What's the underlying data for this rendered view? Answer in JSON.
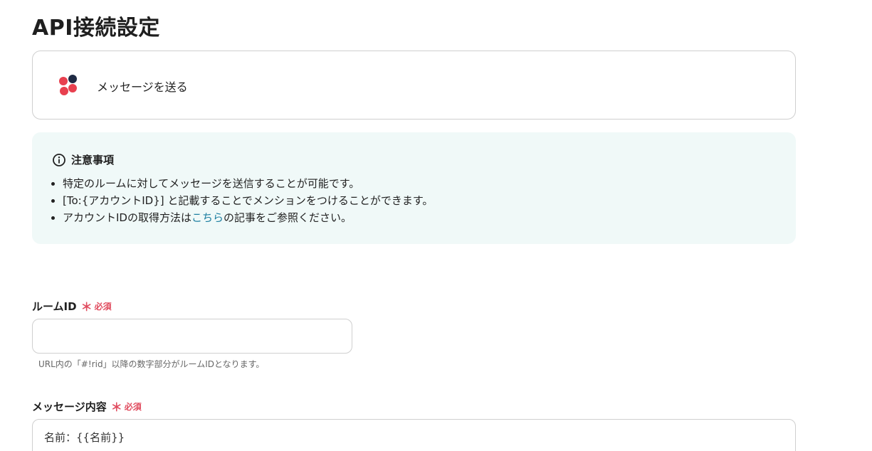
{
  "page": {
    "title": "API接続設定"
  },
  "action": {
    "label": "メッセージを送る",
    "logo_icon": "chatwork-logo-icon"
  },
  "notice": {
    "title": "注意事項",
    "items": [
      "特定のルームに対してメッセージを送信することが可能です。",
      "[To:{アカウントID}] と記載することでメンションをつけることができます。"
    ],
    "item3_prefix": "アカウントIDの取得方法は",
    "item3_link": "こちら",
    "item3_suffix": "の記事をご参照ください。"
  },
  "fields": {
    "room_id": {
      "label": "ルームID",
      "required_mark": "＊",
      "required_text": "必須",
      "value": "",
      "help": "URL内の「#!rid」以降の数字部分がルームIDとなります。"
    },
    "message": {
      "label": "メッセージ内容",
      "required_mark": "＊",
      "required_text": "必須",
      "value": "名前：{{名前}}"
    }
  },
  "colors": {
    "accent_required": "#e04b5e",
    "link": "#1b7ea0",
    "notice_bg": "#f0f9f8",
    "logo_red": "#e8404f",
    "logo_navy": "#1f2a44"
  }
}
